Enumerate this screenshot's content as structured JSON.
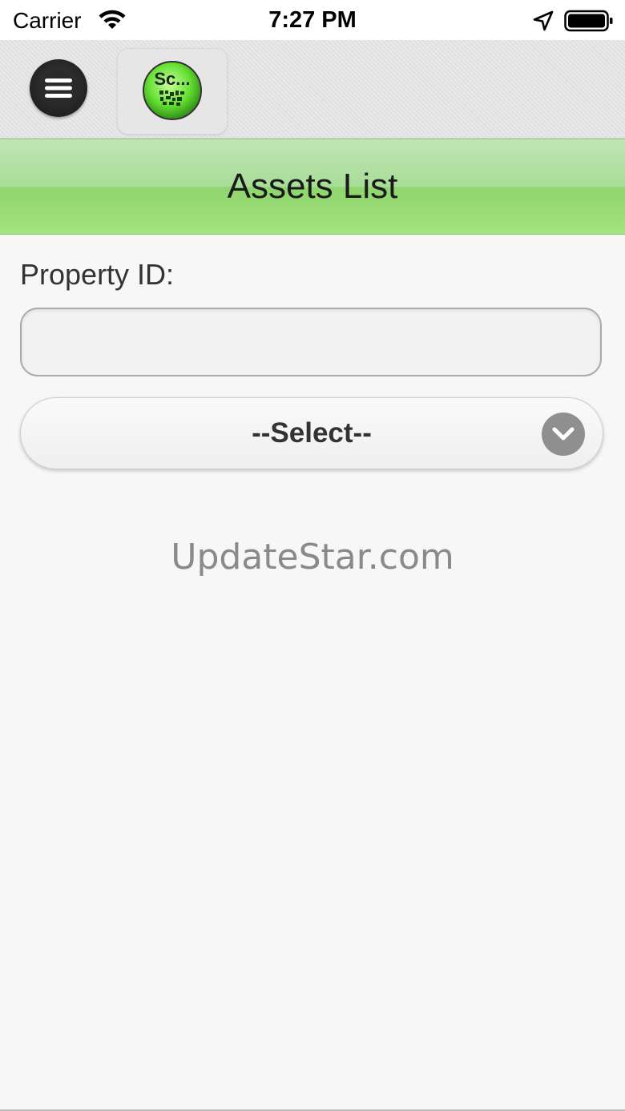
{
  "status_bar": {
    "carrier": "Carrier",
    "time": "7:27 PM",
    "icons": [
      "wifi-icon",
      "location-arrow-icon",
      "battery-icon"
    ]
  },
  "toolbar": {
    "menu_icon": "hamburger-menu-icon",
    "scan_icon": "scan-qr-icon",
    "scan_icon_text": "Sc..."
  },
  "header": {
    "title": "Assets List"
  },
  "form": {
    "property_label": "Property ID:",
    "property_value": "",
    "property_placeholder": "",
    "select_value": "--Select--",
    "select_icon": "chevron-down-icon"
  },
  "watermark": "UpdateStar.com",
  "colors": {
    "header_green": "#a4e37f",
    "menu_button": "#222222",
    "chevron_bg": "#8f8f8f"
  }
}
